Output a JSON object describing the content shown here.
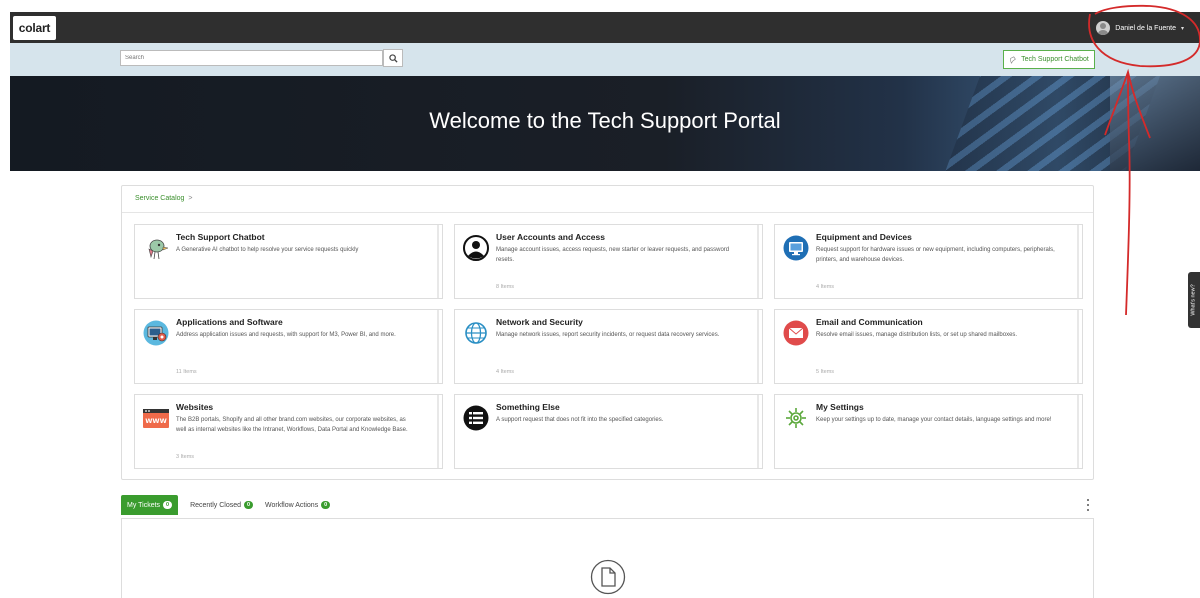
{
  "topbar": {
    "logo_text": "colart",
    "user_name": "Daniel de la Fuente",
    "caret": "▾"
  },
  "search": {
    "placeholder": "Search",
    "chatbot_button": "Tech Support Chatbot"
  },
  "hero": {
    "title": "Welcome to the Tech Support Portal"
  },
  "catalog": {
    "breadcrumb": "Service Catalog",
    "breadcrumb_sep": ">",
    "cards": [
      {
        "title": "Tech Support Chatbot",
        "desc": "A Generative AI chatbot to help resolve your service requests quickly",
        "count": "",
        "icon": "chatbot-icon"
      },
      {
        "title": "User Accounts and Access",
        "desc": "Manage account issues, access requests, new starter or leaver requests, and password resets.",
        "count": "8 Items",
        "icon": "user-account-icon"
      },
      {
        "title": "Equipment and Devices",
        "desc": "Request support for hardware issues or new equipment, including computers, peripherals, printers, and warehouse devices.",
        "count": "4 Items",
        "icon": "monitor-icon"
      },
      {
        "title": "Applications and Software",
        "desc": "Address application issues and requests, with support for M3, Power BI, and more.",
        "count": "11 Items",
        "icon": "software-icon"
      },
      {
        "title": "Network and Security",
        "desc": "Manage network issues, report security incidents, or request data recovery services.",
        "count": "4 Items",
        "icon": "globe-icon"
      },
      {
        "title": "Email and Communication",
        "desc": "Resolve email issues, manage distribution lists, or set up shared mailboxes.",
        "count": "5 Items",
        "icon": "email-icon"
      },
      {
        "title": "Websites",
        "desc": "The B2B portals, Shopify and all other brand.com websites, our corporate websites, as well as internal websites like the Intranet, Workflows, Data Portal and Knowledge Base.",
        "count": "3 Items",
        "icon": "www-icon"
      },
      {
        "title": "Something Else",
        "desc": "A support request that does not fit into the specified categories.",
        "count": "",
        "icon": "list-icon"
      },
      {
        "title": "My Settings",
        "desc": "Keep your settings up to date, manage your contact details, language settings and more!",
        "count": "",
        "icon": "gear-icon"
      }
    ]
  },
  "tabs": [
    {
      "label": "My Tickets",
      "count": "0"
    },
    {
      "label": "Recently Closed",
      "count": "0"
    },
    {
      "label": "Workflow Actions",
      "count": "0"
    }
  ],
  "side_tab": "What's new?",
  "colors": {
    "accent_green": "#3a9c2e",
    "topbar": "#2f2f2f",
    "search_row": "#d6e4ec",
    "annotation_red": "#d42a2a"
  }
}
